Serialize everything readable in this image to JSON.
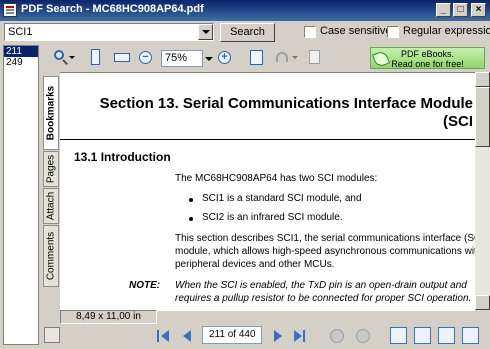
{
  "window": {
    "title": "PDF Search - MC68HC908AP64.pdf",
    "minimize_glyph": "_",
    "maximize_glyph": "□",
    "close_glyph": "×"
  },
  "search": {
    "query": "SCI1",
    "button_label": "Search",
    "case_sensitive_label": "Case sensitive",
    "case_sensitive_checked": false,
    "regex_label": "Regular expression",
    "regex_checked": false
  },
  "toolbar": {
    "zoom_value": "75%",
    "zoom_out_glyph": "−",
    "zoom_in_glyph": "+",
    "ebooks_line1": "PDF eBooks.",
    "ebooks_line2": "Read one for free!"
  },
  "results": {
    "pages": [
      "211",
      "249"
    ],
    "selected_index": 0
  },
  "side_tabs": [
    {
      "label": "Bookmarks",
      "active": true
    },
    {
      "label": "Pages",
      "active": false
    },
    {
      "label": "Attach",
      "active": false
    },
    {
      "label": "Comments",
      "active": false
    }
  ],
  "document": {
    "section_title": "Section 13.  Serial Communications Interface Module",
    "section_title_cont": "(SCI",
    "subheading": "13.1  Introduction",
    "para1": "The MC68HC908AP64 has two SCI modules:",
    "bullet1": "SCI1 is a standard SCI module, and",
    "bullet2": "SCI2 is an infrared SCI module.",
    "para2_line1": "This section describes SCI1, the serial communications interface (SC",
    "para2_line2": "module, which allows high-speed asynchronous communications wit",
    "para2_line3": "peripheral devices and other MCUs.",
    "note_label": "NOTE:",
    "note_line1": "When the SCI is enabled, the TxD pin is an open-drain output and",
    "note_line2": "requires a pullup resistor to be connected for proper SCI operation."
  },
  "status": {
    "page_size": "8,49 x 11,00 in",
    "page_indicator": "211 of 440"
  },
  "colors": {
    "title_bar": "#0b246a",
    "selection": "#0a246a",
    "nav_blue": "#3b6ec4",
    "ebooks_green": "#8fd46a"
  }
}
